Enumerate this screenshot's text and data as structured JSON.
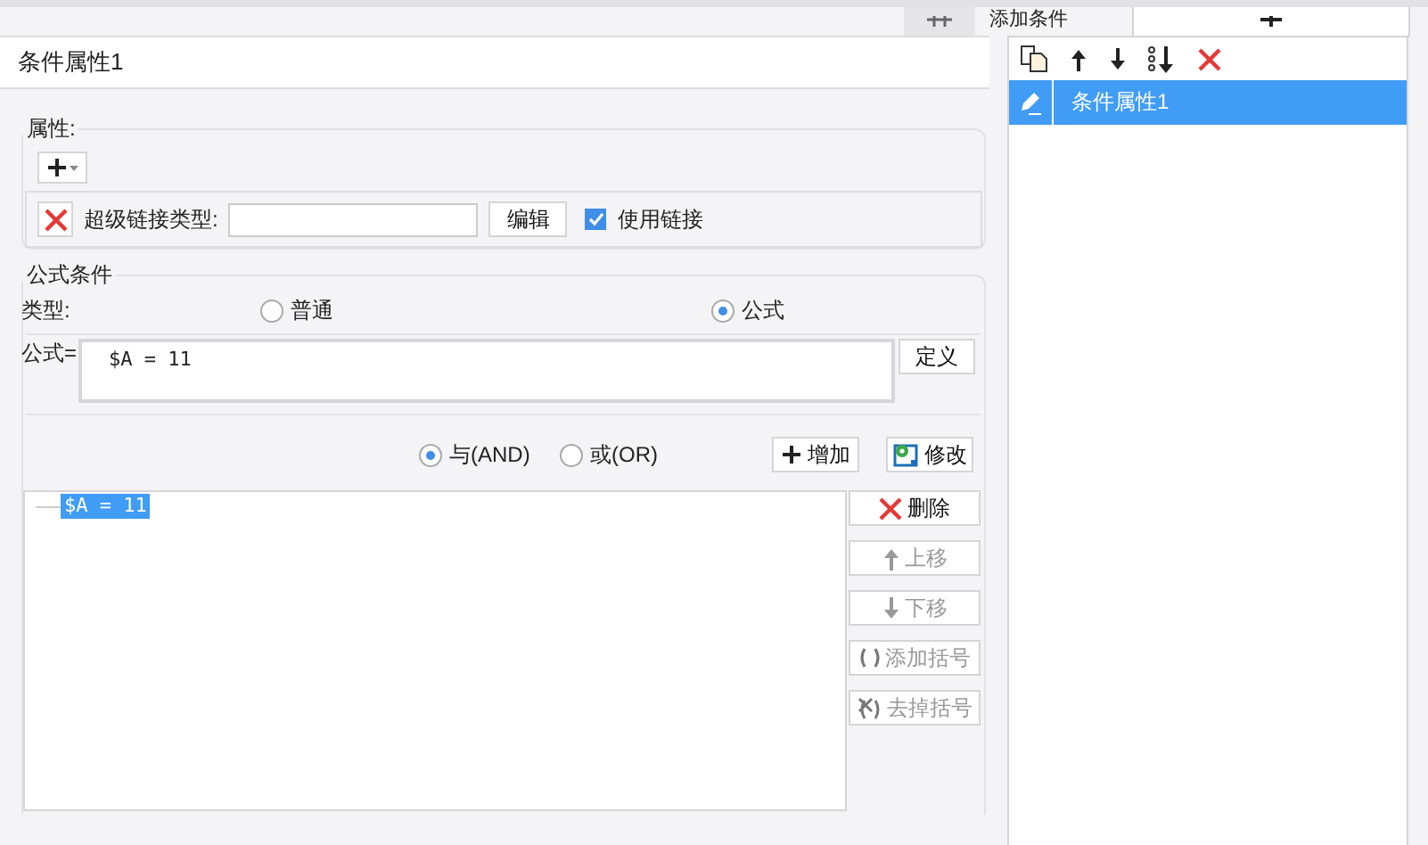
{
  "top_tab": {
    "label": "添加条件"
  },
  "title": "条件属性1",
  "properties": {
    "legend": "属性:",
    "hyperlink": {
      "label": "超级链接类型:",
      "edit_button": "编辑",
      "use_link": {
        "label": "使用链接",
        "checked": true
      }
    }
  },
  "formula_condition": {
    "legend": "公式条件",
    "type_label": "类型:",
    "types": [
      {
        "label": "普通",
        "selected": false
      },
      {
        "label": "公式",
        "selected": true
      }
    ],
    "formula_label": "公式=",
    "formula_value": "$A = 11",
    "define_button": "定义",
    "logic": [
      {
        "label": "与(AND)",
        "selected": true
      },
      {
        "label": "或(OR)",
        "selected": false
      }
    ],
    "add_button": "增加",
    "modify_button": "修改",
    "conditions": [
      {
        "text": "$A = 11",
        "selected": true
      }
    ],
    "actions": [
      {
        "kind": "delete",
        "label": "删除",
        "disabled": false
      },
      {
        "kind": "up",
        "label": "上移",
        "disabled": true
      },
      {
        "kind": "down",
        "label": "下移",
        "disabled": true
      },
      {
        "kind": "add-brackets",
        "label": "添加括号",
        "disabled": true
      },
      {
        "kind": "remove-brackets",
        "label": "去掉括号",
        "disabled": true
      }
    ]
  },
  "condition_list": {
    "items": [
      {
        "label": "条件属性1",
        "selected": true
      }
    ]
  }
}
